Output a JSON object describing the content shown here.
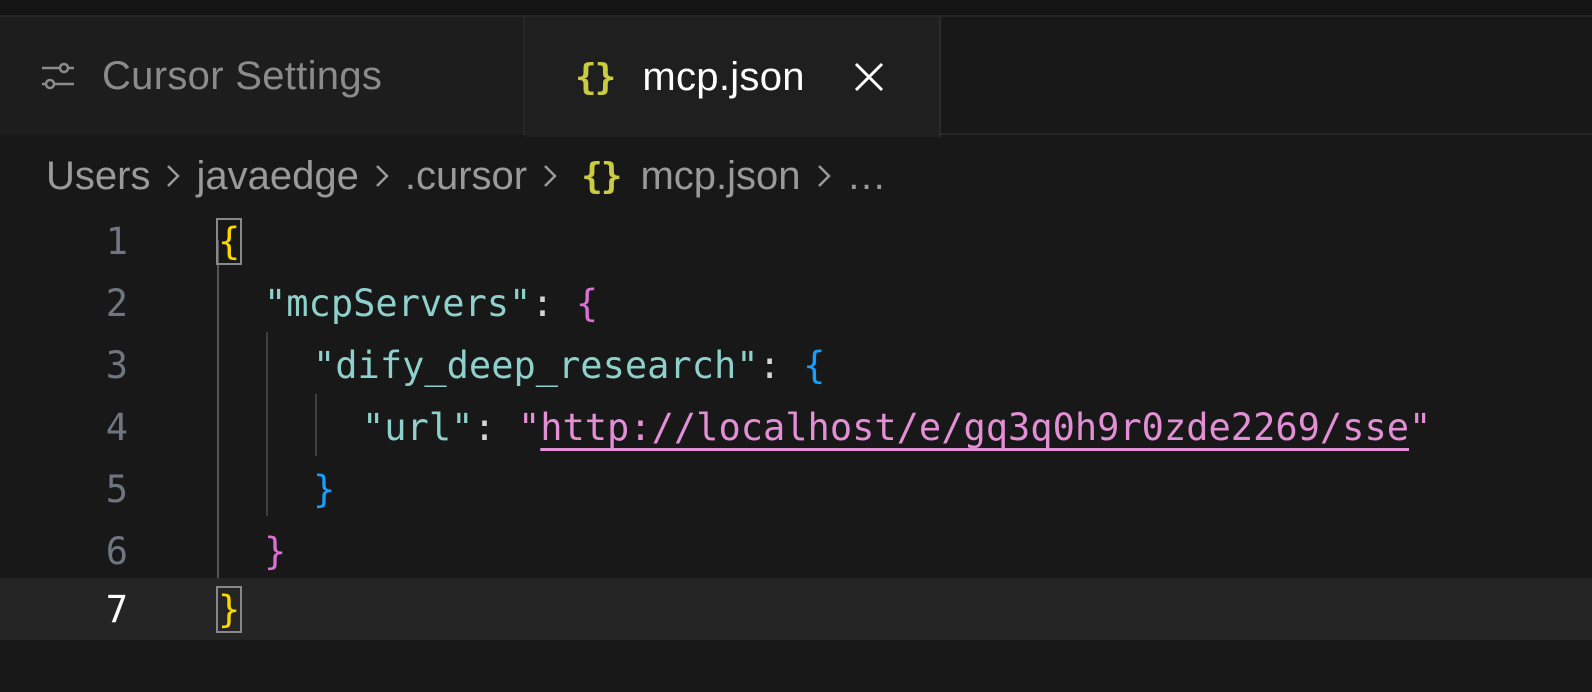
{
  "tabs": [
    {
      "label": "Cursor Settings",
      "icon": "sliders-icon",
      "active": false
    },
    {
      "label": "mcp.json",
      "icon": "braces-icon",
      "icon_glyph": "{}",
      "active": true
    }
  ],
  "breadcrumb": {
    "items": [
      "Users",
      "javaedge",
      ".cursor",
      "mcp.json",
      "…"
    ],
    "file_icon_glyph": "{}"
  },
  "editor": {
    "current_line": 7,
    "line_numbers": [
      "1",
      "2",
      "3",
      "4",
      "5",
      "6",
      "7"
    ],
    "tokens": {
      "open_brace": "{",
      "close_brace": "}",
      "colon": ": ",
      "quote": "\"",
      "key_mcpServers": "\"mcpServers\"",
      "key_dify": "\"dify_deep_research\"",
      "key_url": "\"url\"",
      "url_value": "http://localhost/e/gq3q0h9r0zde2269/sse"
    }
  },
  "colors": {
    "background": "#181818",
    "json_key": "#8ed1cc",
    "string_value": "#e28fd6",
    "bracket_level1": "#ffd700",
    "bracket_level2": "#da70d6",
    "bracket_level3": "#179fff",
    "json_icon": "#cbcb41"
  }
}
